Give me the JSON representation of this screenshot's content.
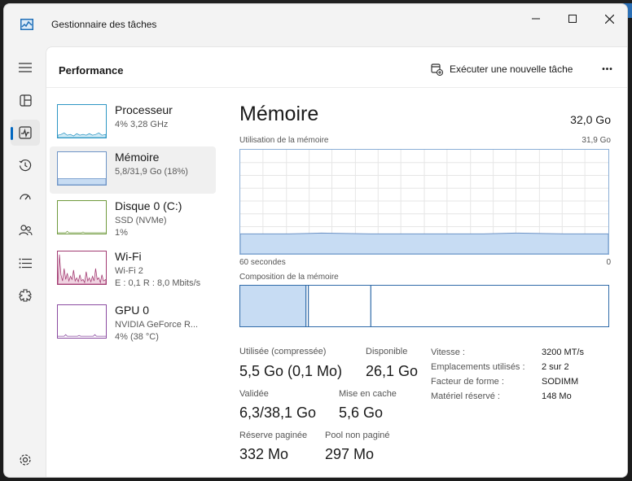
{
  "window": {
    "title": "Gestionnaire des tâches",
    "controls": {
      "minimize": "—",
      "maximize": "☐",
      "close": "✕"
    }
  },
  "nav": {
    "items": [
      {
        "name": "hamburger-menu-icon",
        "glyph": "☰"
      },
      {
        "name": "processes-icon",
        "glyph": "▦"
      },
      {
        "name": "performance-icon",
        "glyph": "📈",
        "active": true
      },
      {
        "name": "app-history-icon",
        "glyph": "⟲"
      },
      {
        "name": "startup-apps-icon",
        "glyph": "⟆"
      },
      {
        "name": "users-icon",
        "glyph": "👥"
      },
      {
        "name": "details-icon",
        "glyph": "≣"
      },
      {
        "name": "services-icon",
        "glyph": "⚙"
      }
    ],
    "settings_icon": "⚙"
  },
  "header": {
    "title": "Performance",
    "run_task_label": "Exécuter une nouvelle tâche",
    "more_label": "•••"
  },
  "resources": [
    {
      "name": "Processeur",
      "line1": "4% 3,28 GHz",
      "line2": "",
      "color": "#2d96c4"
    },
    {
      "name": "Mémoire",
      "line1": "5,8/31,9 Go (18%)",
      "line2": "",
      "color": "#6d93c6",
      "selected": true
    },
    {
      "name": "Disque 0 (C:)",
      "line1": "SSD (NVMe)",
      "line2": "1%",
      "color": "#6f9a3c"
    },
    {
      "name": "Wi-Fi",
      "line1": "Wi-Fi 2",
      "line2": "E : 0,1 R : 8,0 Mbits/s",
      "color": "#a23b72"
    },
    {
      "name": "GPU 0",
      "line1": "NVIDIA GeForce R...",
      "line2": "4% (38 °C)",
      "color": "#8a4aa0"
    }
  ],
  "memory": {
    "title": "Mémoire",
    "total": "32,0 Go",
    "usage_label": "Utilisation de la mémoire",
    "usage_max": "31,9 Go",
    "time_left": "60 secondes",
    "time_right": "0",
    "composition_label": "Composition de la mémoire",
    "usage_fraction": 0.18,
    "stats": {
      "used_label": "Utilisée (compressée)",
      "used_value": "5,5 Go (0,1 Mo)",
      "available_label": "Disponible",
      "available_value": "26,1 Go",
      "committed_label": "Validée",
      "committed_value": "6,3/38,1 Go",
      "cached_label": "Mise en cache",
      "cached_value": "5,6 Go",
      "paged_label": "Réserve paginée",
      "paged_value": "332 Mo",
      "nonpaged_label": "Pool non paginé",
      "nonpaged_value": "297 Mo"
    },
    "specs": [
      {
        "label": "Vitesse :",
        "value": "3200 MT/s"
      },
      {
        "label": "Emplacements utilisés :",
        "value": "2 sur 2"
      },
      {
        "label": "Facteur de forme :",
        "value": "SODIMM"
      },
      {
        "label": "Matériel réservé :",
        "value": "148 Mo"
      }
    ]
  }
}
